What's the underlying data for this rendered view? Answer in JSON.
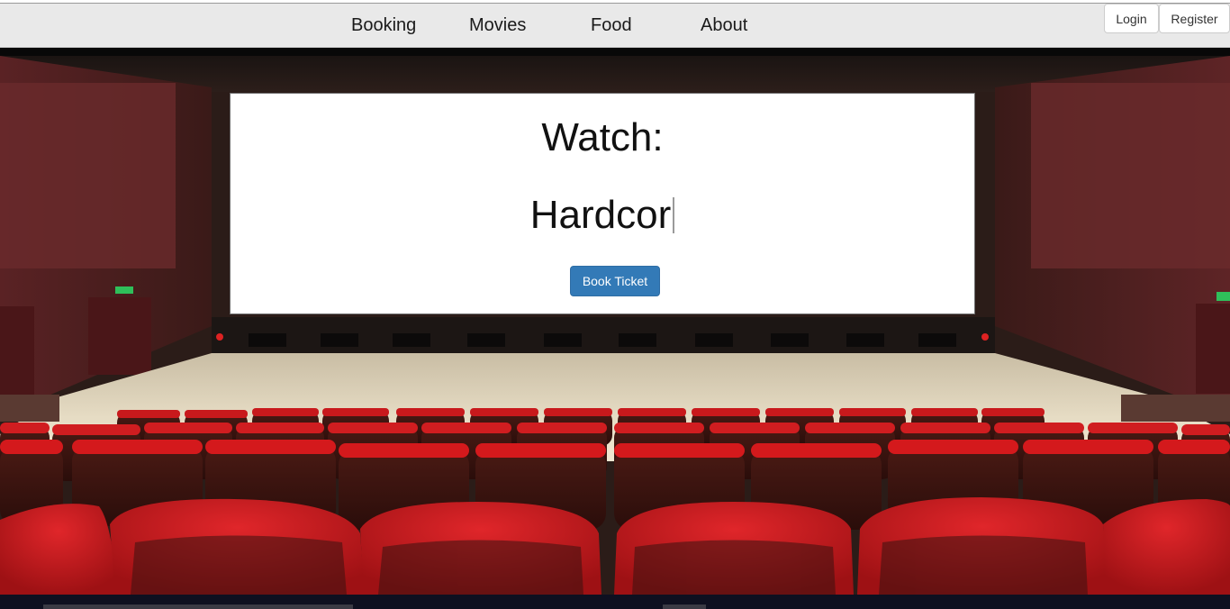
{
  "nav": {
    "links": [
      "Booking",
      "Movies",
      "Food",
      "About"
    ]
  },
  "auth": {
    "login_label": "Login",
    "register_label": "Register"
  },
  "hero": {
    "watch_label": "Watch:",
    "movie_title": "Hardcor",
    "book_button_label": "Book Ticket"
  },
  "colors": {
    "primary_button": "#337ab7",
    "navbar_bg": "#e9e9e9",
    "seat_red": "#c8191c"
  }
}
